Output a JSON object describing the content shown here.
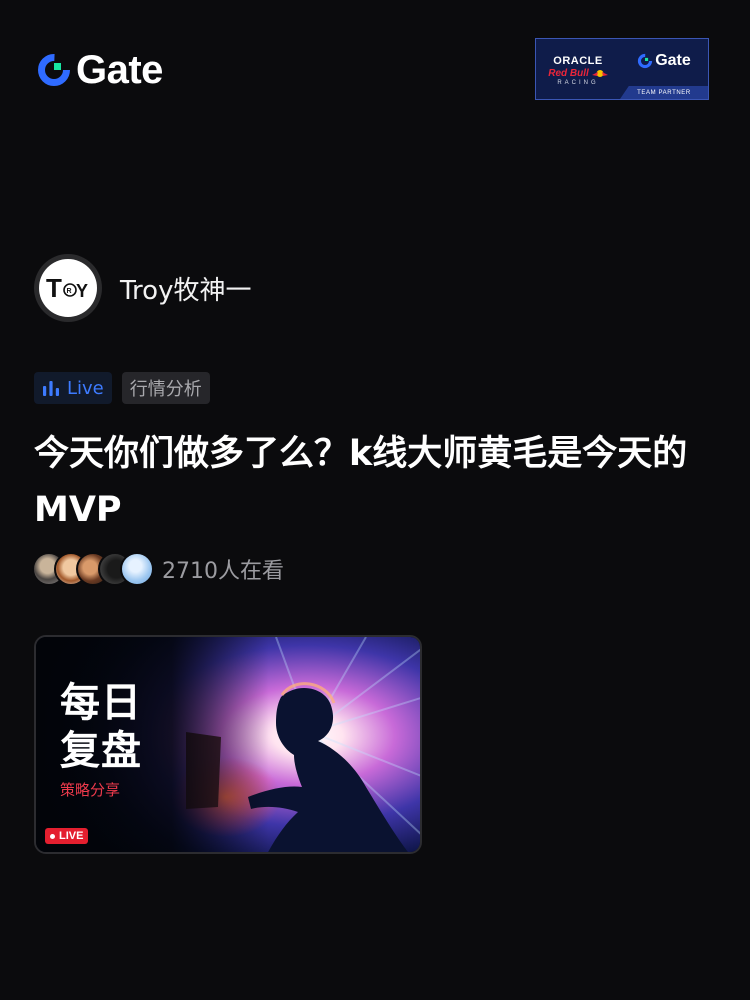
{
  "header": {
    "brand_name": "Gate",
    "partner": {
      "oracle": "ORACLE",
      "red_bull": "Red Bull",
      "racing": "RACING",
      "gate": "Gate",
      "team_partner": "TEAM PARTNER"
    }
  },
  "author": {
    "name": "Troy牧神一",
    "avatar_text": "TROY"
  },
  "tags": {
    "live_label": "Live",
    "category_label": "行情分析"
  },
  "post": {
    "title": "今天你们做多了么？k线大师黄毛是今天的MVP"
  },
  "viewers": {
    "count_text": "2710人在看"
  },
  "stream_card": {
    "title_line1": "每日",
    "title_line2": "复盘",
    "subtitle": "策略分享",
    "live_badge": "LIVE"
  },
  "colors": {
    "background": "#0b0b0d",
    "accent_blue": "#3d7bff",
    "live_red": "#e41f2f",
    "brand_green": "#17e6a1"
  }
}
